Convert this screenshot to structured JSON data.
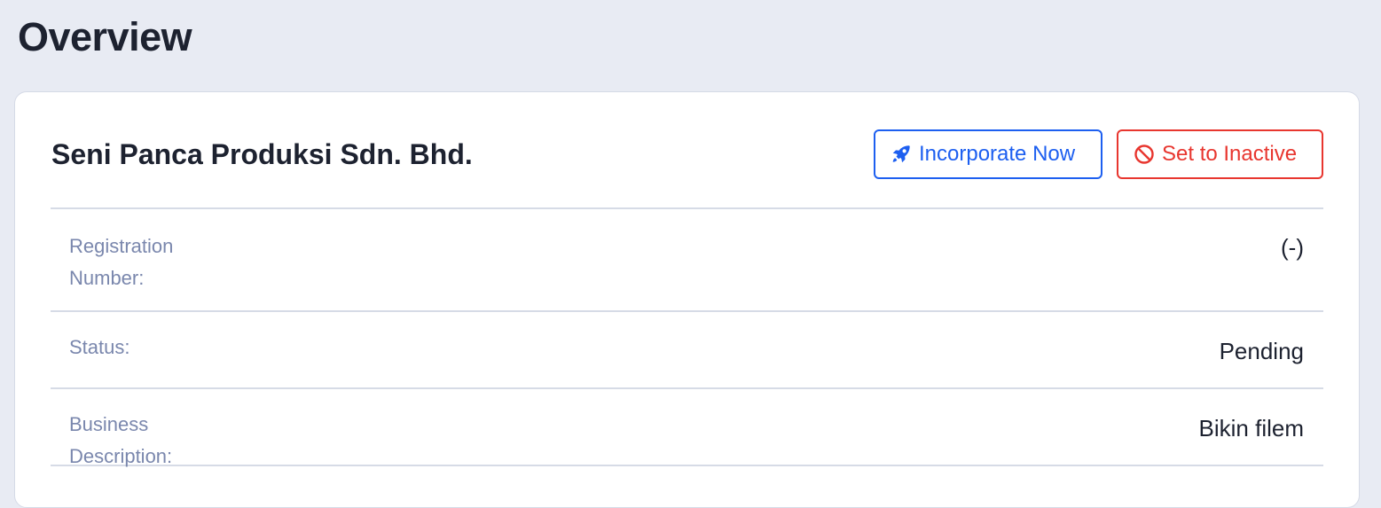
{
  "page": {
    "title": "Overview"
  },
  "company": {
    "name": "Seni Panca Produksi Sdn. Bhd."
  },
  "actions": {
    "incorporate_label": "Incorporate Now",
    "set_inactive_label": "Set to Inactive"
  },
  "details": {
    "registration": {
      "label": "Registration Number:",
      "value": "(-)"
    },
    "status": {
      "label": "Status:",
      "value": "Pending"
    },
    "business_description": {
      "label": "Business Description:",
      "value": "Bikin filem"
    }
  },
  "icons": {
    "incorporate": "rocket-icon",
    "set_inactive": "ban-icon"
  },
  "colors": {
    "page_background": "#e8ebf3",
    "card_background": "#ffffff",
    "primary": "#1d5ff0",
    "danger": "#e8362f",
    "label": "#7a87ad",
    "text": "#1d2230"
  }
}
